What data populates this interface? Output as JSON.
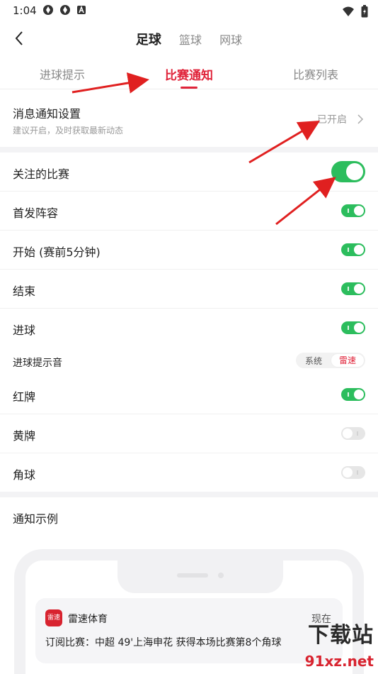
{
  "statusbar": {
    "time": "1:04"
  },
  "nav": {
    "sports": [
      "足球",
      "篮球",
      "网球"
    ]
  },
  "subtabs": [
    "进球提示",
    "比赛通知",
    "比赛列表"
  ],
  "message_settings": {
    "title": "消息通知设置",
    "subtitle": "建议开启，及时获取最新动态",
    "status": "已开启"
  },
  "settings": [
    {
      "label": "关注的比赛",
      "on": true
    },
    {
      "label": "首发阵容",
      "on": true
    },
    {
      "label": "开始 (赛前5分钟)",
      "on": true
    },
    {
      "label": "结束",
      "on": true
    },
    {
      "label": "进球",
      "on": true
    }
  ],
  "sound": {
    "label": "进球提示音",
    "options": [
      "系统",
      "雷速"
    ],
    "selected": "雷速"
  },
  "settings2": [
    {
      "label": "红牌",
      "on": true
    },
    {
      "label": "黄牌",
      "on": false
    },
    {
      "label": "角球",
      "on": false
    }
  ],
  "example": {
    "title": "通知示例",
    "app_name": "雷速体育",
    "time": "现在",
    "body": "订阅比赛：中超 49'上海申花 获得本场比赛第8个角球"
  },
  "watermark": {
    "line1": "下载站",
    "line2": "91xz.net"
  },
  "colors": {
    "accent": "#e0243a",
    "toggle_on": "#2cbd5d",
    "annotation": "#e02020"
  }
}
